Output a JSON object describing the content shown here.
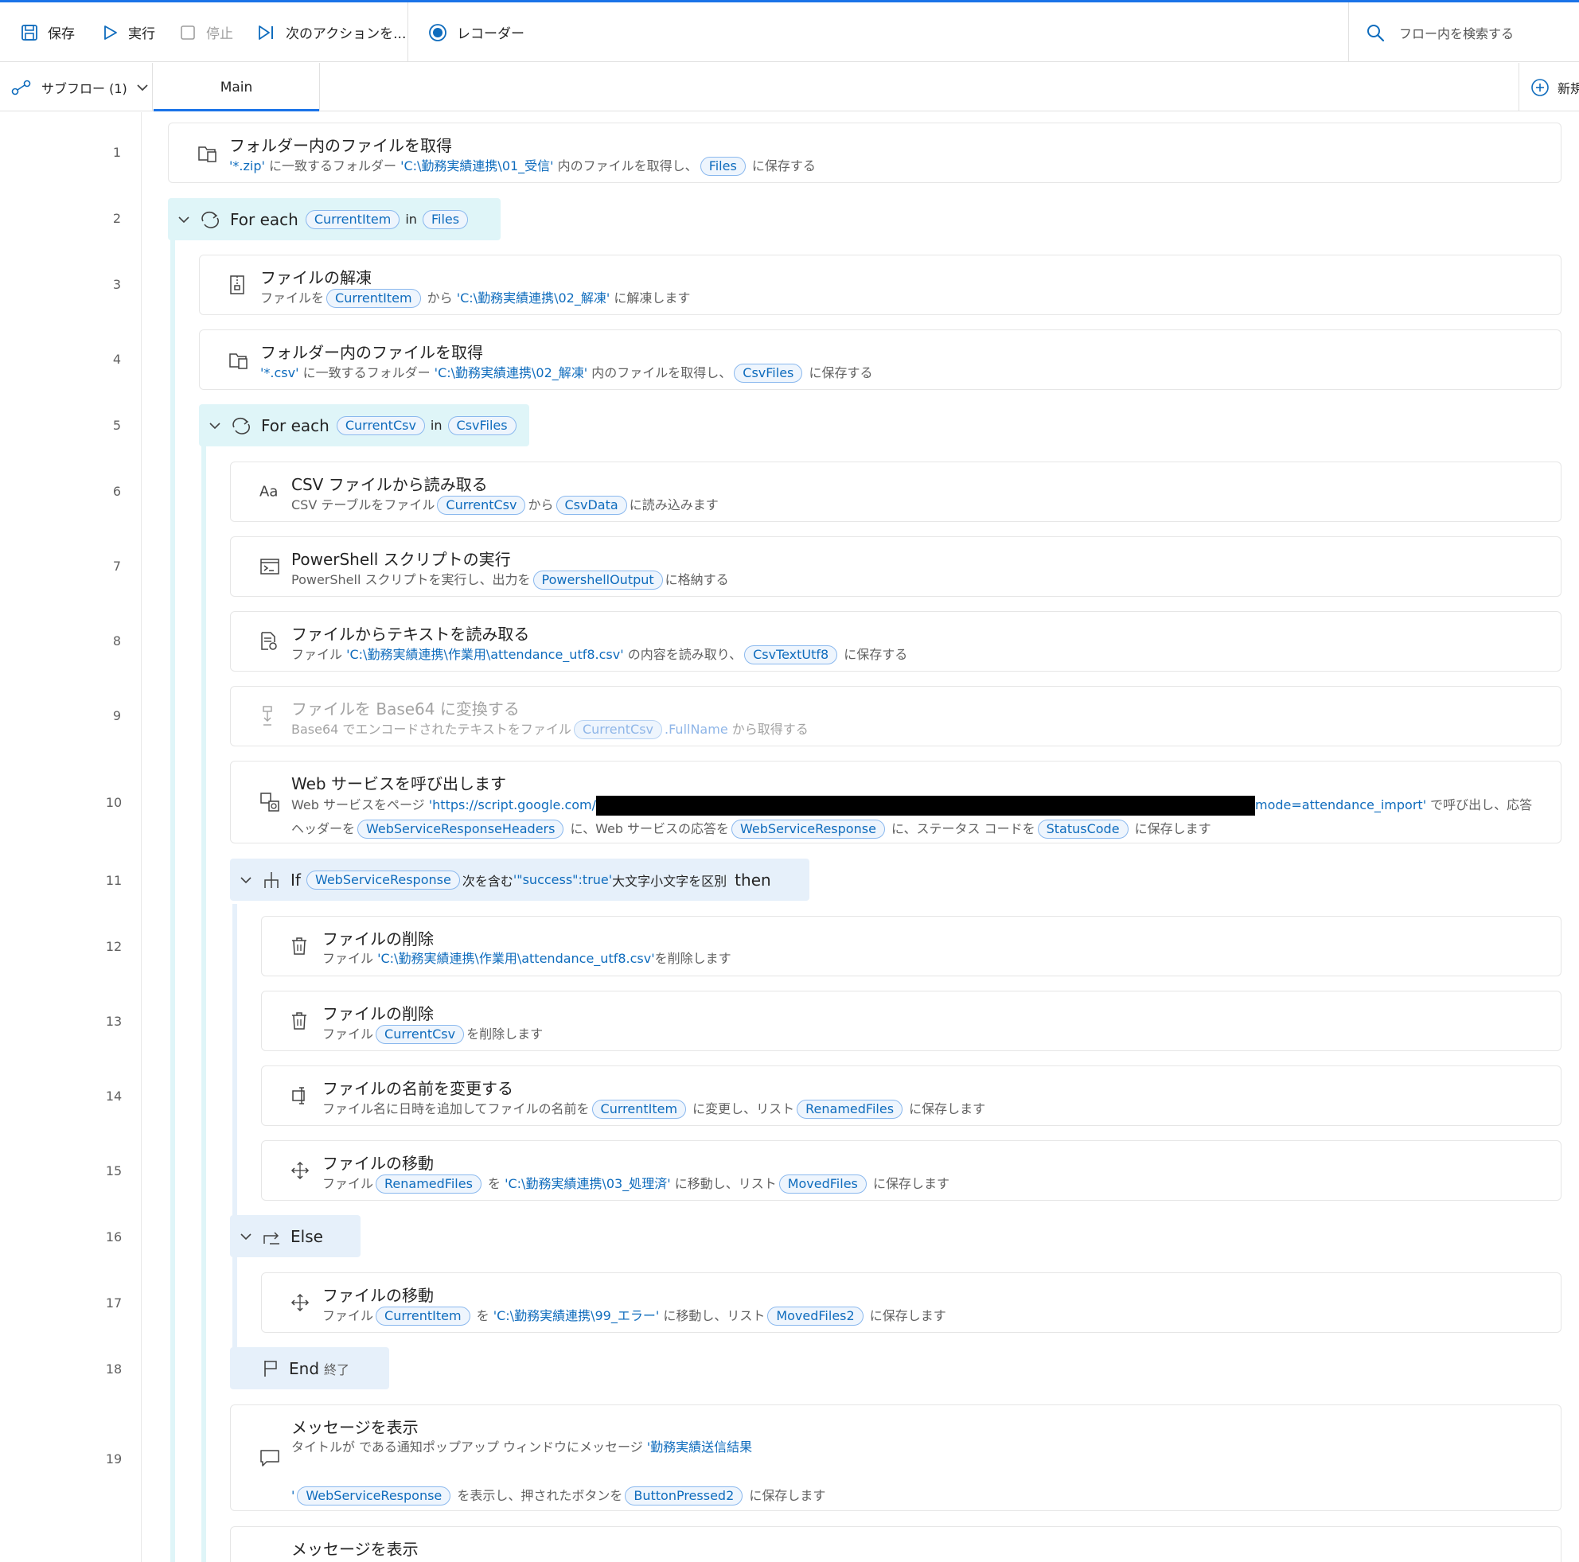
{
  "toolbar": {
    "save": "保存",
    "run": "実行",
    "stop": "停止",
    "next_action": "次のアクションを...",
    "recorder": "レコーダー",
    "search_placeholder": "フロー内を検索する"
  },
  "tabs": {
    "subflow": "サブフロー (1)",
    "main": "Main",
    "new": "新規"
  },
  "line_numbers": [
    "1",
    "2",
    "3",
    "4",
    "5",
    "6",
    "7",
    "8",
    "9",
    "10",
    "11",
    "12",
    "13",
    "14",
    "15",
    "16",
    "17",
    "18",
    "19"
  ],
  "steps": {
    "s1": {
      "title": "フォルダー内のファイルを取得",
      "p1": "'*.zip'",
      "t1": " に一致するフォルダー ",
      "p2": "'C:\\勤務実績連携\\01_受信'",
      "t2": " 内のファイルを取得し、",
      "v1": "Files",
      "t3": " に保存する"
    },
    "s2": {
      "kw": "For each",
      "v1": "CurrentItem",
      "in": "in",
      "v2": "Files"
    },
    "s3": {
      "title": "ファイルの解凍",
      "t1": "ファイルを",
      "v1": "CurrentItem",
      "t2": " から ",
      "p1": "'C:\\勤務実績連携\\02_解凍'",
      "t3": " に解凍します"
    },
    "s4": {
      "title": "フォルダー内のファイルを取得",
      "p1": "'*.csv'",
      "t1": " に一致するフォルダー ",
      "p2": "'C:\\勤務実績連携\\02_解凍'",
      "t2": " 内のファイルを取得し、",
      "v1": "CsvFiles",
      "t3": " に保存する"
    },
    "s5": {
      "kw": "For each",
      "v1": "CurrentCsv",
      "in": "in",
      "v2": "CsvFiles"
    },
    "s6": {
      "title": "CSV ファイルから読み取る",
      "t1": "CSV テーブルをファイル",
      "v1": "CurrentCsv",
      "t2": "から",
      "v2": "CsvData",
      "t3": "に読み込みます"
    },
    "s7": {
      "title": "PowerShell スクリプトの実行",
      "t1": "PowerShell スクリプトを実行し、出力を",
      "v1": "PowershellOutput",
      "t2": "に格納する"
    },
    "s8": {
      "title": "ファイルからテキストを読み取る",
      "t1": "ファイル ",
      "p1": "'C:\\勤務実績連携\\作業用\\attendance_utf8.csv'",
      "t2": " の内容を読み取り、",
      "v1": "CsvTextUtf8",
      "t3": " に保存する"
    },
    "s9": {
      "title": "ファイルを Base64 に変換する",
      "t1": "Base64 でエンコードされたテキストをファイル",
      "v1": "CurrentCsv",
      "p1": ".FullName",
      "t2": " から取得する"
    },
    "s10": {
      "title": "Web サービスを呼び出します",
      "t1": "Web サービスをページ ",
      "p1": "'https://script.google.com/",
      "p2": "mode=attendance_import'",
      "t2": " で呼び出し、応答",
      "t3": "ヘッダーを",
      "v1": "WebServiceResponseHeaders",
      "t4": " に、Web サービスの応答を",
      "v2": "WebServiceResponse",
      "t5": " に、ステータス コードを",
      "v3": "StatusCode",
      "t6": " に保存します"
    },
    "s11": {
      "kw": "If",
      "v1": "WebServiceResponse",
      "t1": "次を含む",
      "p1": "'\"success\":true'",
      "t2": "大文字小文字を区別",
      "kw2": "then"
    },
    "s12": {
      "title": "ファイルの削除",
      "t1": "ファイル ",
      "p1": "'C:\\勤務実績連携\\作業用\\attendance_utf8.csv'",
      "t2": "を削除します"
    },
    "s13": {
      "title": "ファイルの削除",
      "t1": "ファイル",
      "v1": "CurrentCsv",
      "t2": "を削除します"
    },
    "s14": {
      "title": "ファイルの名前を変更する",
      "t1": "ファイル名に日時を追加してファイルの名前を",
      "v1": "CurrentItem",
      "t2": " に変更し、リスト",
      "v2": "RenamedFiles",
      "t3": " に保存します"
    },
    "s15": {
      "title": "ファイルの移動",
      "t1": "ファイル",
      "v1": "RenamedFiles",
      "t2": " を ",
      "p1": "'C:\\勤務実績連携\\03_処理済'",
      "t3": " に移動し、リスト",
      "v2": "MovedFiles",
      "t4": " に保存します"
    },
    "s16": {
      "kw": "Else"
    },
    "s17": {
      "title": "ファイルの移動",
      "t1": "ファイル",
      "v1": "CurrentItem",
      "t2": " を ",
      "p1": "'C:\\勤務実績連携\\99_エラー'",
      "t3": " に移動し、リスト",
      "v2": "MovedFiles2",
      "t4": " に保存します"
    },
    "s18": {
      "kw": "End",
      "t1": "終了"
    },
    "s19": {
      "title": "メッセージを表示",
      "t1": "タイトルが  である通知ポップアップ ウィンドウにメッセージ ",
      "p1": "'勤務実績送信結果",
      "p2": "'",
      "v1": "WebServiceResponse",
      "t2": " を表示し、押されたボタンを",
      "v2": "ButtonPressed2",
      "t3": " に保存します"
    },
    "s20": {
      "title": "メッセージを表示"
    }
  }
}
